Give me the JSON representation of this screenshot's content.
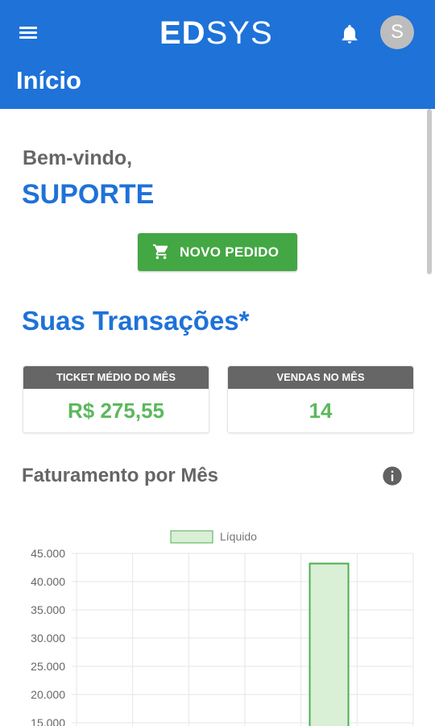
{
  "app": {
    "brand_bold": "ED",
    "brand_rest": "SYS",
    "page_title": "Início",
    "avatar_letter": "S",
    "icons": [
      "menu-icon",
      "bell-icon",
      "cart-icon",
      "info-icon"
    ],
    "colors": {
      "primary": "#1e72d8",
      "success_button": "#43a743",
      "value_green": "#5cb85c",
      "card_header": "#666666"
    }
  },
  "welcome": {
    "greeting": "Bem-vindo,",
    "user": "SUPORTE"
  },
  "actions": {
    "new_order_label": "NOVO PEDIDO"
  },
  "transactions": {
    "title": "Suas Transações*",
    "cards": [
      {
        "label": "TICKET MÉDIO DO MÊS",
        "value": "R$ 275,55"
      },
      {
        "label": "VENDAS NO MÊS",
        "value": "14"
      }
    ]
  },
  "revenue": {
    "title": "Faturamento por Mês"
  },
  "chart_data": {
    "type": "bar",
    "series": [
      {
        "name": "Líquido",
        "values": [
          0,
          0,
          0,
          0,
          43200,
          0
        ]
      }
    ],
    "categories": [
      "",
      "",
      "",
      "",
      "",
      ""
    ],
    "y_ticks": [
      "45.000",
      "40.000",
      "35.000",
      "30.000",
      "25.000",
      "20.000",
      "15.000"
    ],
    "ylim": [
      15000,
      45000
    ],
    "legend": "top-center",
    "grid": true,
    "colors": {
      "bar_fill": "#d9efd6",
      "bar_stroke": "#4caf50",
      "grid": "#e6e6e6"
    }
  }
}
